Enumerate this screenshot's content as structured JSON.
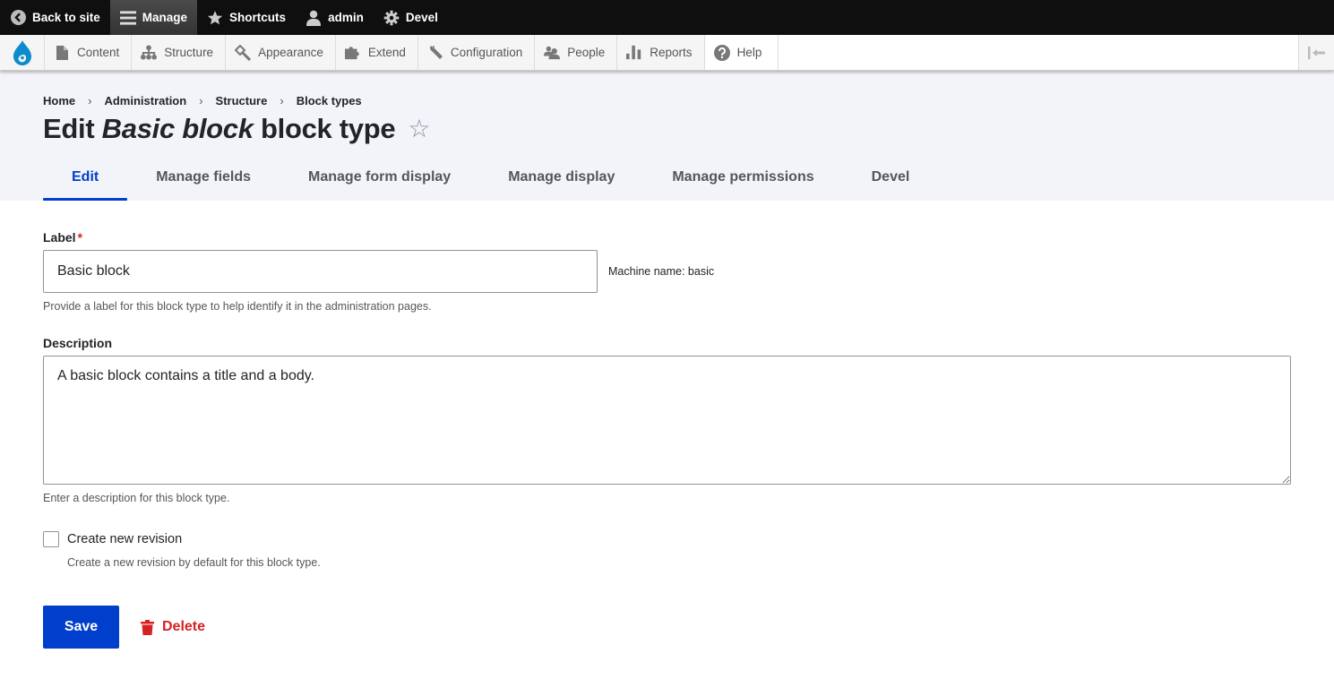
{
  "toolbar": {
    "back_to_site": "Back to site",
    "manage": "Manage",
    "shortcuts": "Shortcuts",
    "user": "admin",
    "devel": "Devel"
  },
  "admin_menu": {
    "items": [
      {
        "label": "Content",
        "icon": "file-icon"
      },
      {
        "label": "Structure",
        "icon": "sitemap-icon"
      },
      {
        "label": "Appearance",
        "icon": "paintbrush-icon"
      },
      {
        "label": "Extend",
        "icon": "puzzle-icon"
      },
      {
        "label": "Configuration",
        "icon": "wrench-icon"
      },
      {
        "label": "People",
        "icon": "people-icon"
      },
      {
        "label": "Reports",
        "icon": "bar-chart-icon"
      },
      {
        "label": "Help",
        "icon": "question-icon"
      }
    ]
  },
  "breadcrumb": [
    "Home",
    "Administration",
    "Structure",
    "Block types"
  ],
  "breadcrumb_separator": "›",
  "page_title": {
    "prefix": "Edit ",
    "emphasis": "Basic block",
    "suffix": " block type",
    "star": "☆"
  },
  "tabs": [
    {
      "label": "Edit",
      "active": true
    },
    {
      "label": "Manage fields",
      "active": false
    },
    {
      "label": "Manage form display",
      "active": false
    },
    {
      "label": "Manage display",
      "active": false
    },
    {
      "label": "Manage permissions",
      "active": false
    },
    {
      "label": "Devel",
      "active": false
    }
  ],
  "form": {
    "label_field": {
      "label": "Label",
      "required_marker": "*",
      "value": "Basic block",
      "machine_name": "Machine name: basic",
      "help": "Provide a label for this block type to help identify it in the administration pages."
    },
    "description_field": {
      "label": "Description",
      "value": "A basic block contains a title and a body.",
      "help": "Enter a description for this block type."
    },
    "revision_checkbox": {
      "label": "Create new revision",
      "checked": false,
      "help": "Create a new revision by default for this block type."
    },
    "save_label": "Save",
    "delete_label": "Delete"
  },
  "colors": {
    "primary": "#003ecc",
    "danger": "#d72222",
    "toolbar_bg": "#0f0f0f",
    "header_bg": "#f3f4f9",
    "drupal_blue": "#0c8ccd"
  }
}
